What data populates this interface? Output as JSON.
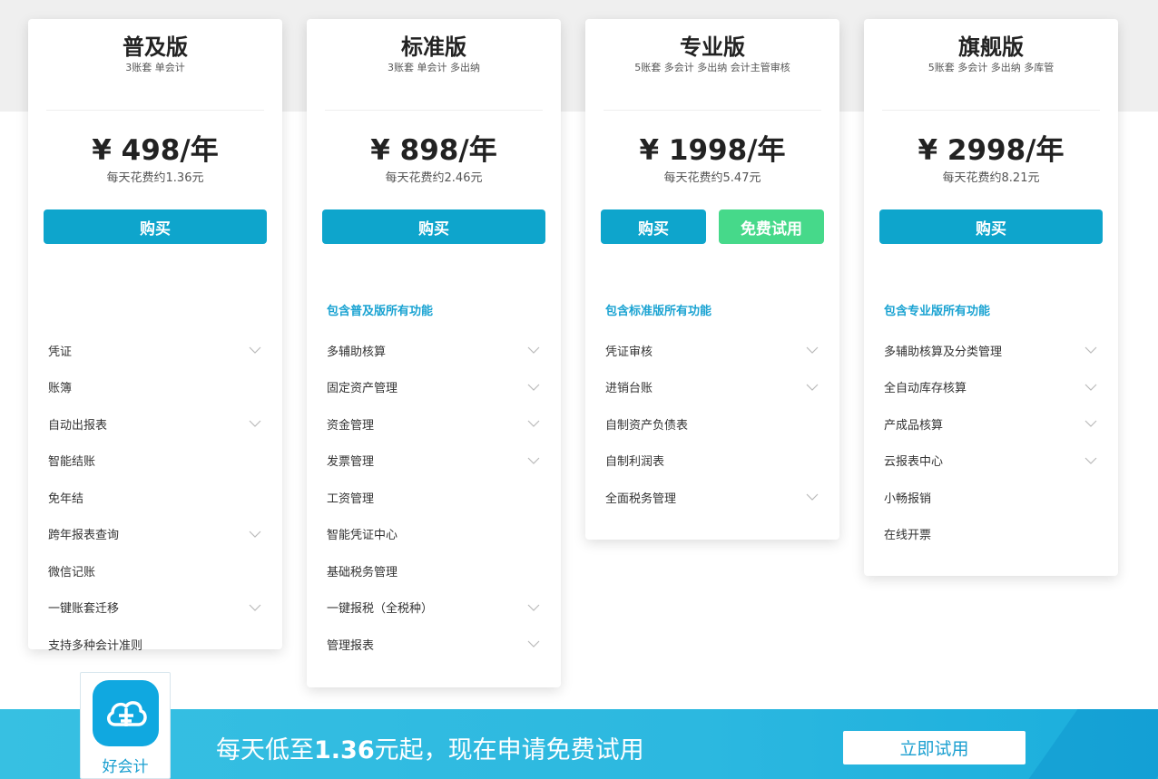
{
  "plans": [
    {
      "name": "普及版",
      "sub": "3账套 单会计",
      "price": "¥ 498/年",
      "daily": "每天花费约1.36元",
      "buy_label": "购买",
      "features_head": "",
      "features": [
        {
          "label": "凭证",
          "expandable": true
        },
        {
          "label": "账簿",
          "expandable": false
        },
        {
          "label": "自动出报表",
          "expandable": true
        },
        {
          "label": "智能结账",
          "expandable": false
        },
        {
          "label": "免年结",
          "expandable": false
        },
        {
          "label": "跨年报表查询",
          "expandable": true
        },
        {
          "label": "微信记账",
          "expandable": false
        },
        {
          "label": "一键账套迁移",
          "expandable": true
        },
        {
          "label": "支持多种会计准则",
          "expandable": false
        }
      ]
    },
    {
      "name": "标准版",
      "sub": "3账套 单会计 多出纳",
      "price": "¥ 898/年",
      "daily": "每天花费约2.46元",
      "buy_label": "购买",
      "features_head": "包含普及版所有功能",
      "features": [
        {
          "label": "多辅助核算",
          "expandable": true
        },
        {
          "label": "固定资产管理",
          "expandable": true
        },
        {
          "label": "资金管理",
          "expandable": true
        },
        {
          "label": "发票管理",
          "expandable": true
        },
        {
          "label": "工资管理",
          "expandable": false
        },
        {
          "label": "智能凭证中心",
          "expandable": false
        },
        {
          "label": "基础税务管理",
          "expandable": false
        },
        {
          "label": "一键报税（全税种）",
          "expandable": true
        },
        {
          "label": "管理报表",
          "expandable": true
        }
      ]
    },
    {
      "name": "专业版",
      "sub": "5账套 多会计 多出纳 会计主管审核",
      "price": "¥ 1998/年",
      "daily": "每天花费约5.47元",
      "buy_label": "购买",
      "trial_label": "免费试用",
      "features_head": "包含标准版所有功能",
      "features": [
        {
          "label": "凭证审核",
          "expandable": true
        },
        {
          "label": "进销台账",
          "expandable": true
        },
        {
          "label": "自制资产负债表",
          "expandable": false
        },
        {
          "label": "自制利润表",
          "expandable": false
        },
        {
          "label": "全面税务管理",
          "expandable": true
        }
      ]
    },
    {
      "name": "旗舰版",
      "sub": "5账套 多会计 多出纳 多库管",
      "price": "¥ 2998/年",
      "daily": "每天花费约8.21元",
      "buy_label": "购买",
      "features_head": "包含专业版所有功能",
      "features": [
        {
          "label": "多辅助核算及分类管理",
          "expandable": true
        },
        {
          "label": "全自动库存核算",
          "expandable": true
        },
        {
          "label": "产成品核算",
          "expandable": true
        },
        {
          "label": "云报表中心",
          "expandable": true
        },
        {
          "label": "小畅报销",
          "expandable": false
        },
        {
          "label": "在线开票",
          "expandable": false
        }
      ]
    }
  ],
  "banner": {
    "logo_text": "好会计",
    "promo_prefix": "每天低至",
    "promo_value": "1.36",
    "promo_suffix": "元起，现在申请免费试用",
    "try_label": "立即试用"
  },
  "colors": {
    "accent": "#0ea5cc",
    "trial": "#46d98a",
    "feature_head": "#1aa3d2",
    "banner": "#2cb8e0"
  }
}
